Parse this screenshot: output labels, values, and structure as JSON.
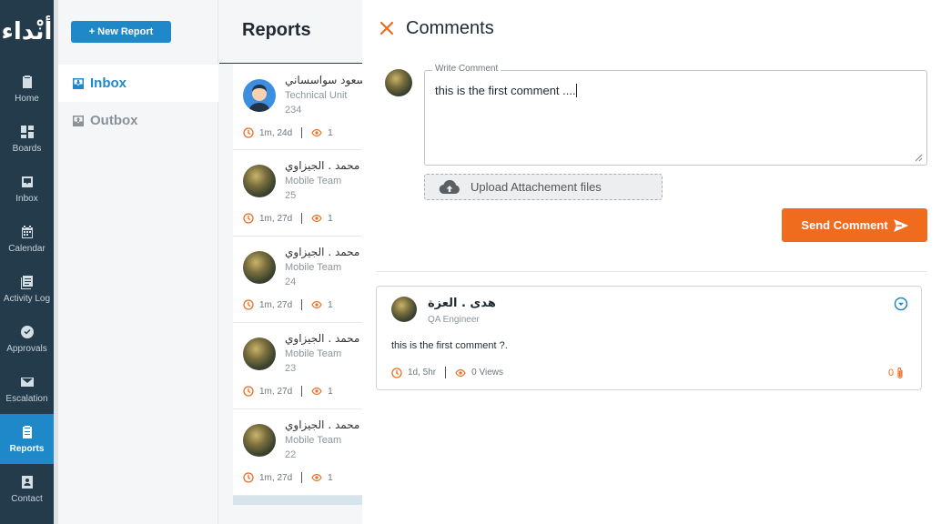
{
  "app": {
    "logo_text": "أنْداء"
  },
  "nav": {
    "items": [
      {
        "label": "Home",
        "icon": "clipboard-icon"
      },
      {
        "label": "Boards",
        "icon": "grid-icon"
      },
      {
        "label": "Inbox",
        "icon": "inbox-icon"
      },
      {
        "label": "Calendar",
        "icon": "calendar-icon"
      },
      {
        "label": "Activity Log",
        "icon": "list-icon"
      },
      {
        "label": "Approvals",
        "icon": "check-circle-icon"
      },
      {
        "label": "Escalation",
        "icon": "envelope-icon"
      },
      {
        "label": "Reports",
        "icon": "report-icon",
        "active": true
      },
      {
        "label": "Contact",
        "icon": "contact-icon"
      }
    ]
  },
  "folders": {
    "new_report_label": "+ New Report",
    "inbox_label": "Inbox",
    "outbox_label": "Outbox"
  },
  "reports": {
    "title": "Reports",
    "cards": [
      {
        "name": "مسعود سواسساني",
        "team": "Technical Unit",
        "id": "234",
        "age": "1m, 24d",
        "views": "1",
        "avatar": "person"
      },
      {
        "name": "محمد . الجيزاوي",
        "team": "Mobile Team",
        "id": "25",
        "age": "1m, 27d",
        "views": "1",
        "avatar": "photo"
      },
      {
        "name": "محمد . الجيزاوي",
        "team": "Mobile Team",
        "id": "24",
        "age": "1m, 27d",
        "views": "1",
        "avatar": "photo"
      },
      {
        "name": "محمد . الجيزاوي",
        "team": "Mobile Team",
        "id": "23",
        "age": "1m, 27d",
        "views": "1",
        "avatar": "photo"
      },
      {
        "name": "محمد . الجيزاوي",
        "team": "Mobile Team",
        "id": "22",
        "age": "1m, 27d",
        "views": "1",
        "avatar": "photo"
      }
    ]
  },
  "comments": {
    "title": "Comments",
    "write_label": "Write Comment",
    "write_value": "this is the first comment ....",
    "upload_label": "Upload Attachement files",
    "send_label": "Send Comment",
    "items": [
      {
        "author": "هدى . العزة",
        "role": "QA Engineer",
        "body": "this is the first comment ?.",
        "age": "1d, 5hr",
        "views": "0 Views",
        "attachments": "0"
      }
    ]
  },
  "colors": {
    "nav_bg": "#233b4a",
    "accent_blue": "#1e88c9",
    "accent_orange": "#ef6c1f"
  }
}
